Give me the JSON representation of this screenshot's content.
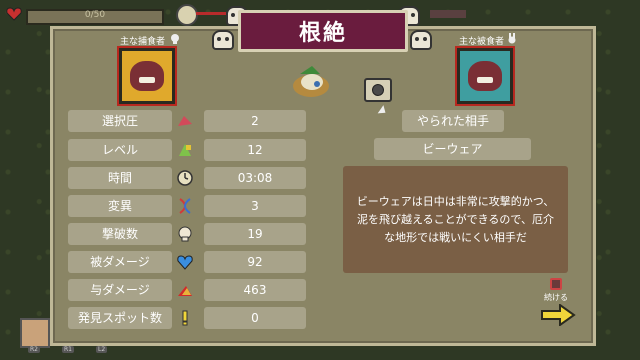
{
  "hud": {
    "hp_text": "0/50"
  },
  "banner": {
    "title": "根絶"
  },
  "predator": {
    "label": "主な捕食者"
  },
  "prey": {
    "label": "主な被食者"
  },
  "stats": [
    {
      "label": "選択圧",
      "value": "2"
    },
    {
      "label": "レベル",
      "value": "12"
    },
    {
      "label": "時間",
      "value": "03:08"
    },
    {
      "label": "変異",
      "value": "3"
    },
    {
      "label": "撃破数",
      "value": "19"
    },
    {
      "label": "被ダメージ",
      "value": "92"
    },
    {
      "label": "与ダメージ",
      "value": "463"
    },
    {
      "label": "発見スポット数",
      "value": "0"
    }
  ],
  "tabs": {
    "killed_by": "やられた相手",
    "creature_name": "ビーウェア"
  },
  "description": "ビーウェアは日中は非常に攻撃的かつ、泥を飛び越えることができるので、厄介な地形では戦いにくい相手だ",
  "continue": {
    "label": "続ける"
  },
  "bottom_tags": [
    "R2",
    "R1",
    "L2"
  ],
  "colors": {
    "banner": "#6a1c3e",
    "panel": "#8a8565",
    "cell": "#a8a38a",
    "desc": "#7a5f45",
    "accent_red": "#b8281f"
  }
}
